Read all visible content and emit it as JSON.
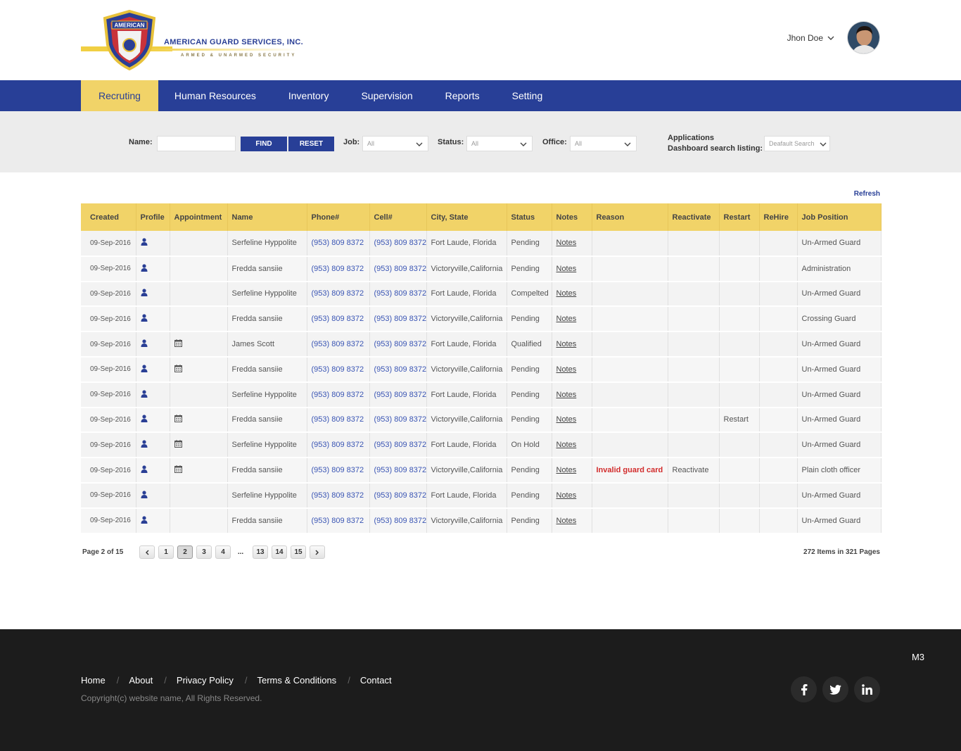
{
  "brand": {
    "company_name": "AMERICAN GUARD SERVICES, INC.",
    "tagline": "ARMED & UNARMED SECURITY",
    "shield_text": "AMERICAN"
  },
  "user": {
    "name": "Jhon Doe"
  },
  "nav": [
    {
      "label": "Recruting",
      "active": true
    },
    {
      "label": "Human Resources"
    },
    {
      "label": "Inventory"
    },
    {
      "label": "Supervision"
    },
    {
      "label": "Reports"
    },
    {
      "label": "Setting"
    }
  ],
  "filter": {
    "name_label": "Name:",
    "name_value": "",
    "find_label": "FIND",
    "reset_label": "RESET",
    "job_label": "Job:",
    "job_value": "All",
    "status_label": "Status:",
    "status_value": "All",
    "office_label": "Office:",
    "office_value": "All",
    "apps_label_1": "Applications",
    "apps_label_2": "Dashboard search listing:",
    "apps_value": "Deafault Search"
  },
  "refresh_label": "Refresh",
  "table": {
    "columns": [
      "Created",
      "Profile",
      "Appointment",
      "Name",
      "Phone#",
      "Cell#",
      "City, State",
      "Status",
      "Notes",
      "Reason",
      "Reactivate",
      "Restart",
      "ReHire",
      "Job Position"
    ],
    "rows": [
      {
        "created": "09-Sep-2016",
        "appt": false,
        "name": "Serfeline Hyppolite",
        "phone": "(953) 809 8372",
        "cell": "(953) 809 8372",
        "city": "Fort Laude, Florida",
        "status": "Pending",
        "notes": "Notes",
        "reason": "",
        "reactivate": "",
        "restart": "",
        "rehire": "",
        "job": "Un-Armed Guard"
      },
      {
        "created": "09-Sep-2016",
        "appt": false,
        "name": "Fredda sansiie",
        "phone": "(953) 809 8372",
        "cell": "(953) 809 8372",
        "city": "Victoryville,California",
        "status": "Pending",
        "notes": "Notes",
        "reason": "",
        "reactivate": "",
        "restart": "",
        "rehire": "",
        "job": "Administration"
      },
      {
        "created": "09-Sep-2016",
        "appt": false,
        "name": "Serfeline Hyppolite",
        "phone": "(953) 809 8372",
        "cell": "(953) 809 8372",
        "city": "Fort Laude, Florida",
        "status": "Compelted",
        "notes": "Notes",
        "reason": "",
        "reactivate": "",
        "restart": "",
        "rehire": "",
        "job": "Un-Armed Guard"
      },
      {
        "created": "09-Sep-2016",
        "appt": false,
        "name": "Fredda sansiie",
        "phone": "(953) 809 8372",
        "cell": "(953) 809 8372",
        "city": "Victoryville,California",
        "status": "Pending",
        "notes": "Notes",
        "reason": "",
        "reactivate": "",
        "restart": "",
        "rehire": "",
        "job": "Crossing Guard"
      },
      {
        "created": "09-Sep-2016",
        "appt": true,
        "name": "James Scott",
        "phone": "(953) 809 8372",
        "cell": "(953) 809 8372",
        "city": "Fort Laude, Florida",
        "status": "Qualified",
        "notes": "Notes",
        "reason": "",
        "reactivate": "",
        "restart": "",
        "rehire": "",
        "job": "Un-Armed Guard"
      },
      {
        "created": "09-Sep-2016",
        "appt": true,
        "name": "Fredda sansiie",
        "phone": "(953) 809 8372",
        "cell": "(953) 809 8372",
        "city": "Victoryville,California",
        "status": "Pending",
        "notes": "Notes",
        "reason": "",
        "reactivate": "",
        "restart": "",
        "rehire": "",
        "job": "Un-Armed Guard"
      },
      {
        "created": "09-Sep-2016",
        "appt": false,
        "name": "Serfeline Hyppolite",
        "phone": "(953) 809 8372",
        "cell": "(953) 809 8372",
        "city": "Fort Laude, Florida",
        "status": "Pending",
        "notes": "Notes",
        "reason": "",
        "reactivate": "",
        "restart": "",
        "rehire": "",
        "job": "Un-Armed Guard"
      },
      {
        "created": "09-Sep-2016",
        "appt": true,
        "name": "Fredda sansiie",
        "phone": "(953) 809 8372",
        "cell": "(953) 809 8372",
        "city": "Victoryville,California",
        "status": "Pending",
        "notes": "Notes",
        "reason": "",
        "reactivate": "",
        "restart": "Restart",
        "rehire": "",
        "job": "Un-Armed Guard"
      },
      {
        "created": "09-Sep-2016",
        "appt": true,
        "name": "Serfeline Hyppolite",
        "phone": "(953) 809 8372",
        "cell": "(953) 809 8372",
        "city": "Fort Laude, Florida",
        "status": "On Hold",
        "notes": "Notes",
        "reason": "",
        "reactivate": "",
        "restart": "",
        "rehire": "",
        "job": "Un-Armed Guard"
      },
      {
        "created": "09-Sep-2016",
        "appt": true,
        "name": "Fredda sansiie",
        "phone": "(953) 809 8372",
        "cell": "(953) 809 8372",
        "city": "Victoryville,California",
        "status": "Pending",
        "notes": "Notes",
        "reason": "Invalid guard card",
        "reactivate": "Reactivate",
        "restart": "",
        "rehire": "",
        "job": "Plain cloth officer"
      },
      {
        "created": "09-Sep-2016",
        "appt": false,
        "name": "Serfeline Hyppolite",
        "phone": "(953) 809 8372",
        "cell": "(953) 809 8372",
        "city": "Fort Laude, Florida",
        "status": "Pending",
        "notes": "Notes",
        "reason": "",
        "reactivate": "",
        "restart": "",
        "rehire": "",
        "job": "Un-Armed Guard"
      },
      {
        "created": "09-Sep-2016",
        "appt": false,
        "name": "Fredda sansiie",
        "phone": "(953) 809 8372",
        "cell": "(953) 809 8372",
        "city": "Victoryville,California",
        "status": "Pending",
        "notes": "Notes",
        "reason": "",
        "reactivate": "",
        "restart": "",
        "rehire": "",
        "job": "Un-Armed Guard"
      }
    ]
  },
  "pagination": {
    "info": "Page 2 of 15",
    "pages": [
      "1",
      "2",
      "3",
      "4",
      "...",
      "13",
      "14",
      "15"
    ],
    "current": "2",
    "items_info": "272 Items in 321 Pages"
  },
  "footer": {
    "badge": "M3",
    "links": [
      "Home",
      "About",
      "Privacy Policy",
      "Terms & Conditions",
      "Contact"
    ],
    "copyright": "Copyright(c) website name, All Rights Reserved."
  },
  "colors": {
    "brand_blue": "#283f97",
    "brand_yellow": "#f1d368",
    "link_blue": "#3a55b4",
    "reason_red": "#d22b2b",
    "footer_bg": "#1c1c1c"
  }
}
